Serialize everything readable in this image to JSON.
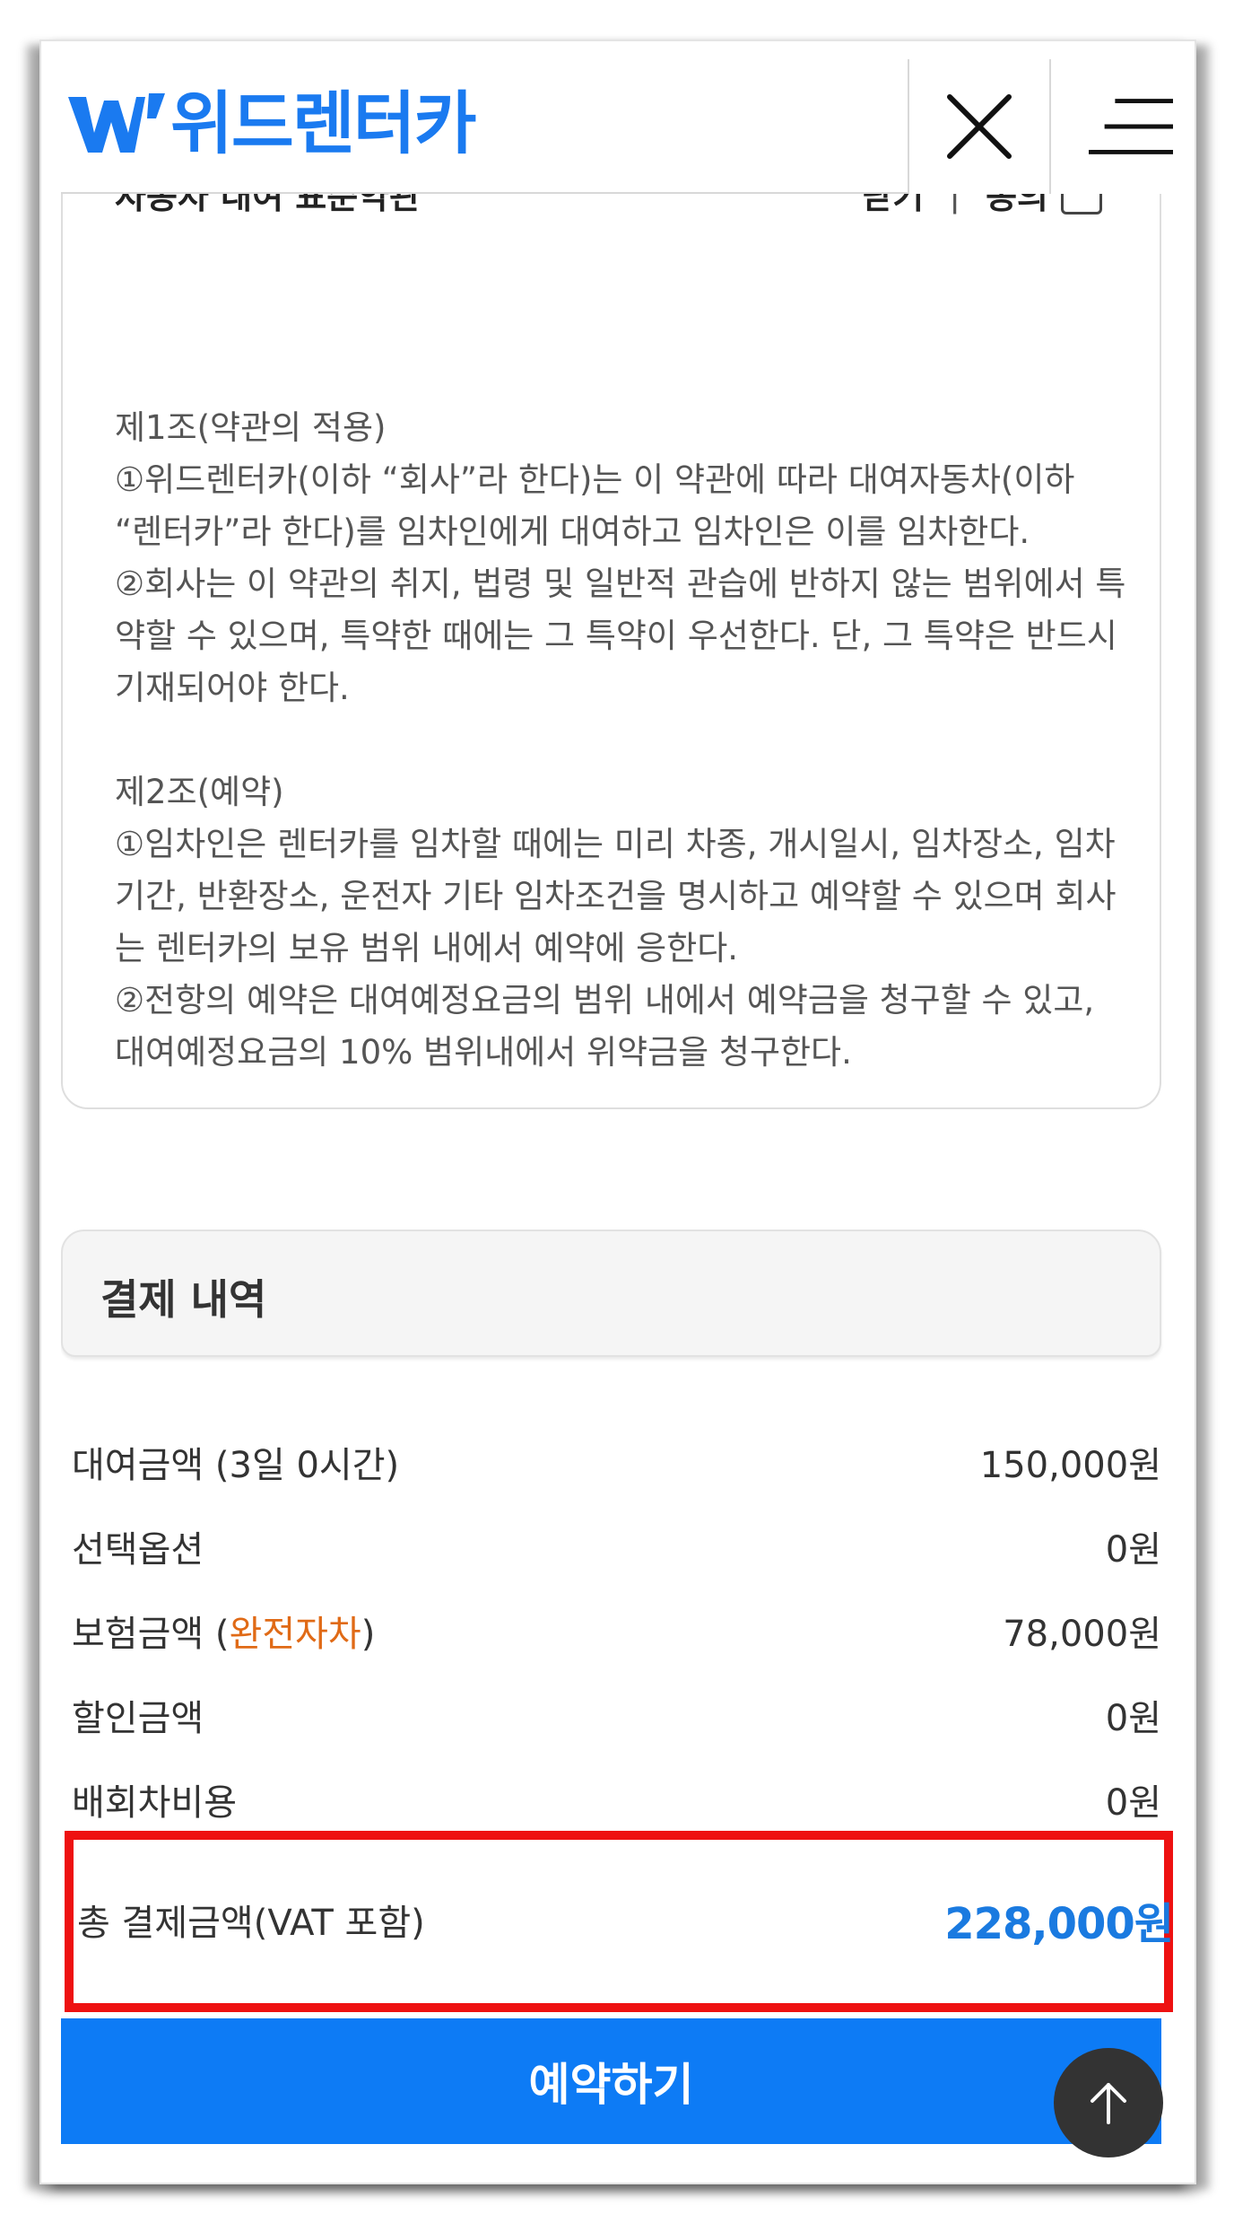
{
  "header": {
    "logo_text": "위드렌터카",
    "close_icon": "close-icon",
    "menu_icon": "hamburger-menu-icon",
    "brand_color": "#1a7af0"
  },
  "terms": {
    "title": "자동차 대여 표준약관",
    "close_label": "닫기",
    "separator": "|",
    "agree_label": "동의",
    "agree_checked": false,
    "paragraphs": [
      "제1조(약관의 적용)",
      "①위드렌터카(이하 “회사”라 한다)는 이 약관에 따라 대여자동차(이하 “렌터카”라 한다)를 임차인에게 대여하고 임차인은 이를 임차한다.",
      "②회사는 이 약관의 취지, 법령 및 일반적 관습에 반하지 않는 범위에서 특약할 수 있으며, 특약한 때에는 그 특약이 우선한다. 단, 그 특약은 반드시 기재되어야 한다.",
      "",
      "제2조(예약)",
      "①임차인은 렌터카를 임차할 때에는 미리 차종, 개시일시, 임차장소, 임차기간, 반환장소, 운전자 기타 임차조건을 명시하고 예약할 수 있으며 회사는 렌터카의 보유 범위 내에서 예약에 응한다.",
      "②전항의 예약은 대여예정요금의 범위 내에서 예약금을 청구할 수 있고, 대여예정요금의 10% 범위내에서 위약금을 청구한다."
    ]
  },
  "payment": {
    "section_title": "결제 내역",
    "rows": [
      {
        "label": "대여금액 (3일 0시간)",
        "value": "150,000원"
      },
      {
        "label": "선택옵션",
        "value": "0원"
      },
      {
        "label_prefix": "보험금액 (",
        "label_accent": "완전자차",
        "label_suffix": ")",
        "value": "78,000원"
      },
      {
        "label": "할인금액",
        "value": "0원"
      },
      {
        "label": "배회차비용",
        "value": "0원"
      }
    ],
    "total_label": "총 결제금액(VAT 포함)",
    "total_value": "228,000원",
    "accent_color": "#e06a16",
    "total_color": "#1a7ae0",
    "highlight_color": "#ee1111"
  },
  "actions": {
    "reserve_label": "예약하기",
    "scroll_top_icon": "arrow-up-icon"
  }
}
